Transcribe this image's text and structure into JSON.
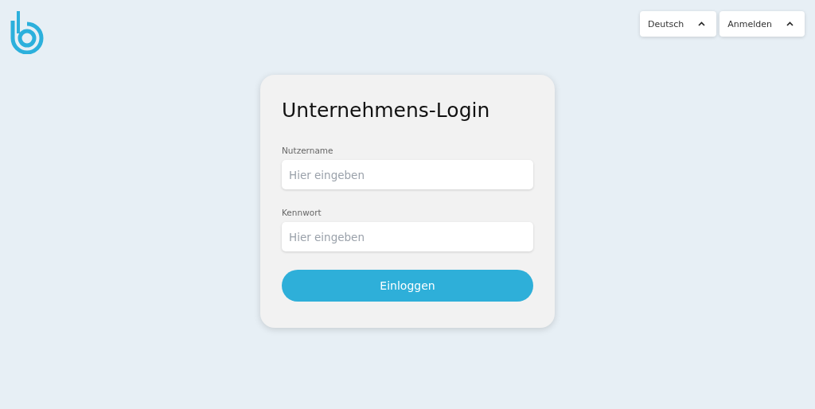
{
  "header": {
    "menus": [
      {
        "label": "Deutsch"
      },
      {
        "label": "Anmelden"
      }
    ]
  },
  "login": {
    "title": "Unternehmens-Login",
    "fields": [
      {
        "label": "Nutzername",
        "placeholder": "Hier eingeben"
      },
      {
        "label": "Kennwort",
        "placeholder": "Hier eingeben"
      }
    ],
    "submit": "Einloggen"
  }
}
